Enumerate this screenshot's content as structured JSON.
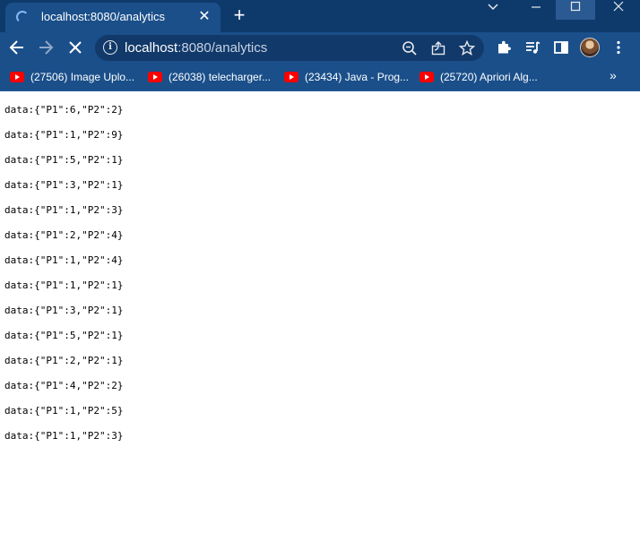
{
  "browser": {
    "tab": {
      "title": "localhost:8080/analytics"
    },
    "address": {
      "host": "localhost",
      "path": ":8080/analytics"
    },
    "bookmarks": [
      {
        "label": "(27506) Image Uplo...",
        "icon": "youtube-icon"
      },
      {
        "label": "(26038) telecharger...",
        "icon": "youtube-icon"
      },
      {
        "label": "(23434) Java - Prog...",
        "icon": "youtube-icon"
      },
      {
        "label": "(25720) Apriori Alg...",
        "icon": "youtube-icon"
      }
    ],
    "more_bookmarks": "»"
  },
  "page": {
    "lines": [
      "data:{\"P1\":6,\"P2\":2}",
      "data:{\"P1\":1,\"P2\":9}",
      "data:{\"P1\":5,\"P2\":1}",
      "data:{\"P1\":3,\"P2\":1}",
      "data:{\"P1\":1,\"P2\":3}",
      "data:{\"P1\":2,\"P2\":4}",
      "data:{\"P1\":1,\"P2\":4}",
      "data:{\"P1\":1,\"P2\":1}",
      "data:{\"P1\":3,\"P2\":1}",
      "data:{\"P1\":5,\"P2\":1}",
      "data:{\"P1\":2,\"P2\":1}",
      "data:{\"P1\":4,\"P2\":2}",
      "data:{\"P1\":1,\"P2\":5}",
      "data:{\"P1\":1,\"P2\":3}"
    ]
  },
  "colors": {
    "titlebar": "#0e3a6b",
    "toolbar": "#1a4f8a",
    "youtube_red": "#ff0000"
  }
}
